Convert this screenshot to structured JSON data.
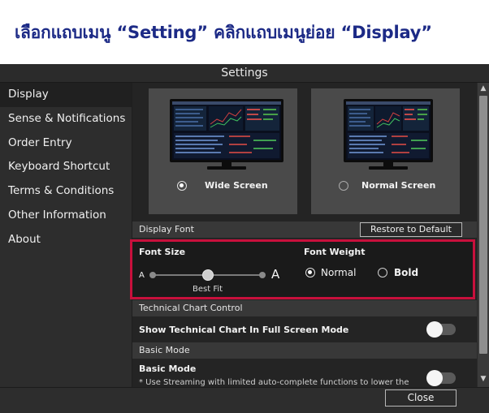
{
  "instruction": "เลือกแถบเมนู “Setting” คลิกแถบเมนูย่อย “Display”",
  "window": {
    "title": "Settings"
  },
  "sidebar": {
    "items": [
      {
        "label": "Display",
        "active": true
      },
      {
        "label": "Sense & Notifications",
        "active": false
      },
      {
        "label": "Order Entry",
        "active": false
      },
      {
        "label": "Keyboard Shortcut",
        "active": false
      },
      {
        "label": "Terms & Conditions",
        "active": false
      },
      {
        "label": "Other Information",
        "active": false
      },
      {
        "label": "About",
        "active": false
      }
    ]
  },
  "screen_options": {
    "wide": {
      "label": "Wide Screen",
      "selected": true
    },
    "normal": {
      "label": "Normal Screen",
      "selected": false
    }
  },
  "display_font": {
    "header": "Display Font",
    "restore_label": "Restore to Default",
    "font_size": {
      "label": "Font Size",
      "min_label": "A",
      "max_label": "A",
      "value_label": "Best Fit",
      "steps": 4,
      "selected_step": 2
    },
    "font_weight": {
      "label": "Font Weight",
      "options": [
        {
          "label": "Normal",
          "selected": true
        },
        {
          "label": "Bold",
          "selected": false
        }
      ]
    }
  },
  "technical_chart": {
    "header": "Technical Chart Control",
    "full_screen_label": "Show Technical Chart In Full Screen Mode",
    "full_screen_on": false
  },
  "basic_mode": {
    "header": "Basic Mode",
    "label": "Basic Mode",
    "description": "* Use Streaming with limited auto-complete functions to lower the",
    "on": false
  },
  "footer": {
    "close_label": "Close"
  },
  "colors": {
    "instruction_text": "#1c2a86",
    "highlight_box": "#c8103c",
    "window_bg": "#2a2a2a"
  }
}
